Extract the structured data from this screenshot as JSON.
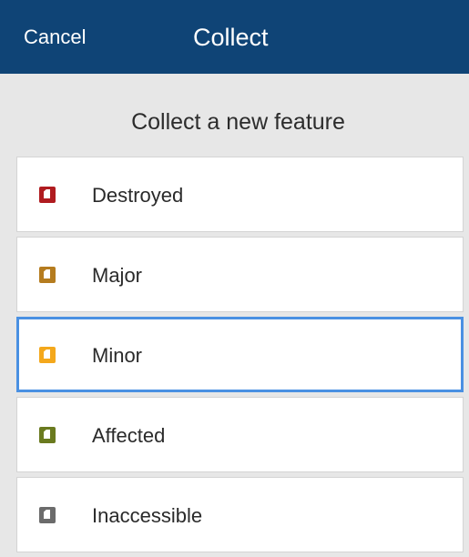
{
  "navbar": {
    "cancel_label": "Cancel",
    "title": "Collect"
  },
  "subheader": {
    "text": "Collect a new feature"
  },
  "features": [
    {
      "label": "Destroyed",
      "icon": "destroyed-building-icon",
      "color": "#b01c20"
    },
    {
      "label": "Major",
      "icon": "major-damage-building-icon",
      "color": "#b57c1f"
    },
    {
      "label": "Minor",
      "icon": "minor-damage-building-icon",
      "color": "#f4a81c",
      "selected": true
    },
    {
      "label": "Affected",
      "icon": "affected-building-icon",
      "color": "#6a7a1f"
    },
    {
      "label": "Inaccessible",
      "icon": "inaccessible-building-icon",
      "color": "#6b6b6b"
    }
  ],
  "colors": {
    "navbar_bg": "#0f4476",
    "selection_border": "#4a90e2"
  }
}
